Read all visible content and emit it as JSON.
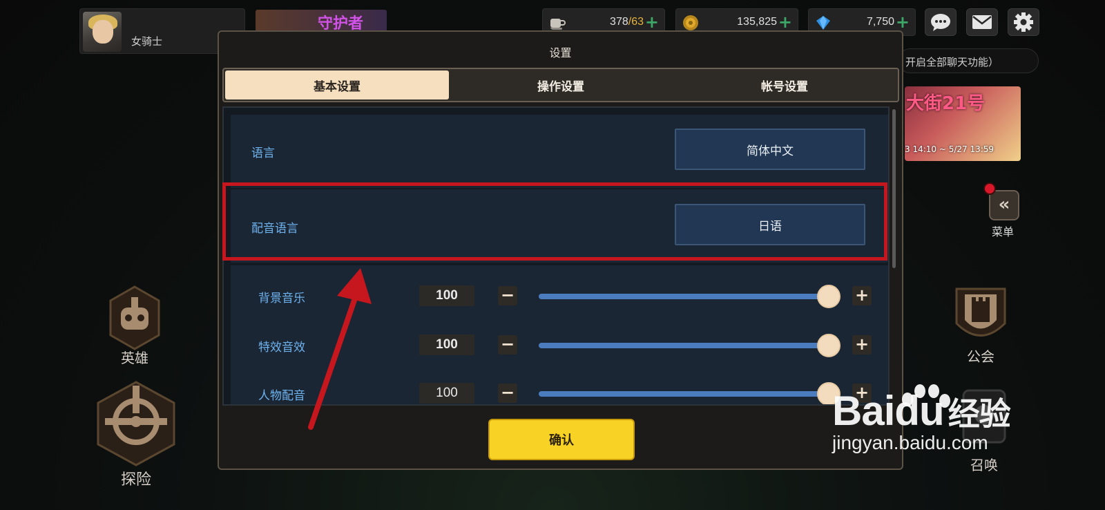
{
  "hud": {
    "player_name": "女骑士",
    "event_banner_title": "守护者",
    "resources": [
      {
        "name": "stamina",
        "value": "378",
        "sub": "/63",
        "icon": "coffee-cup-icon"
      },
      {
        "name": "gold",
        "value": "135,825",
        "sub": "",
        "icon": "gold-coin-icon"
      },
      {
        "name": "gems",
        "value": "7,750",
        "sub": "",
        "icon": "gem-icon"
      }
    ],
    "chat_tip": "开启全部聊天功能）",
    "right_banner": {
      "title": "大街21号",
      "dates": "3 14:10 ~ 5/27 13:59"
    },
    "menu_label": "菜单",
    "menu_glyph": "«"
  },
  "side_icons": {
    "hero": "英雄",
    "explore": "探险",
    "guild": "公会",
    "summon": "召唤"
  },
  "dialog": {
    "title": "设置",
    "tabs": [
      "基本设置",
      "操作设置",
      "帐号设置"
    ],
    "active_tab": 0,
    "language": {
      "label": "语言",
      "value": "简体中文"
    },
    "voice_language": {
      "label": "配音语言",
      "value": "日语"
    },
    "volumes": [
      {
        "label": "背景音乐",
        "value": "100",
        "level": 1.0
      },
      {
        "label": "特效音效",
        "value": "100",
        "level": 1.0
      },
      {
        "label": "人物配音",
        "value": "100",
        "level": 1.0
      }
    ],
    "minus": "−",
    "plus": "+",
    "confirm": "确认"
  },
  "watermark": {
    "logo_latin": "Bai",
    "logo_du": "du",
    "logo_cn": "经验",
    "url": "jingyan.baidu.com"
  },
  "colors": {
    "highlight_box": "#c5171d",
    "confirm_yellow": "#f8d224",
    "label_blue": "#6eb2ee",
    "tab_active": "#f5dfbf"
  }
}
